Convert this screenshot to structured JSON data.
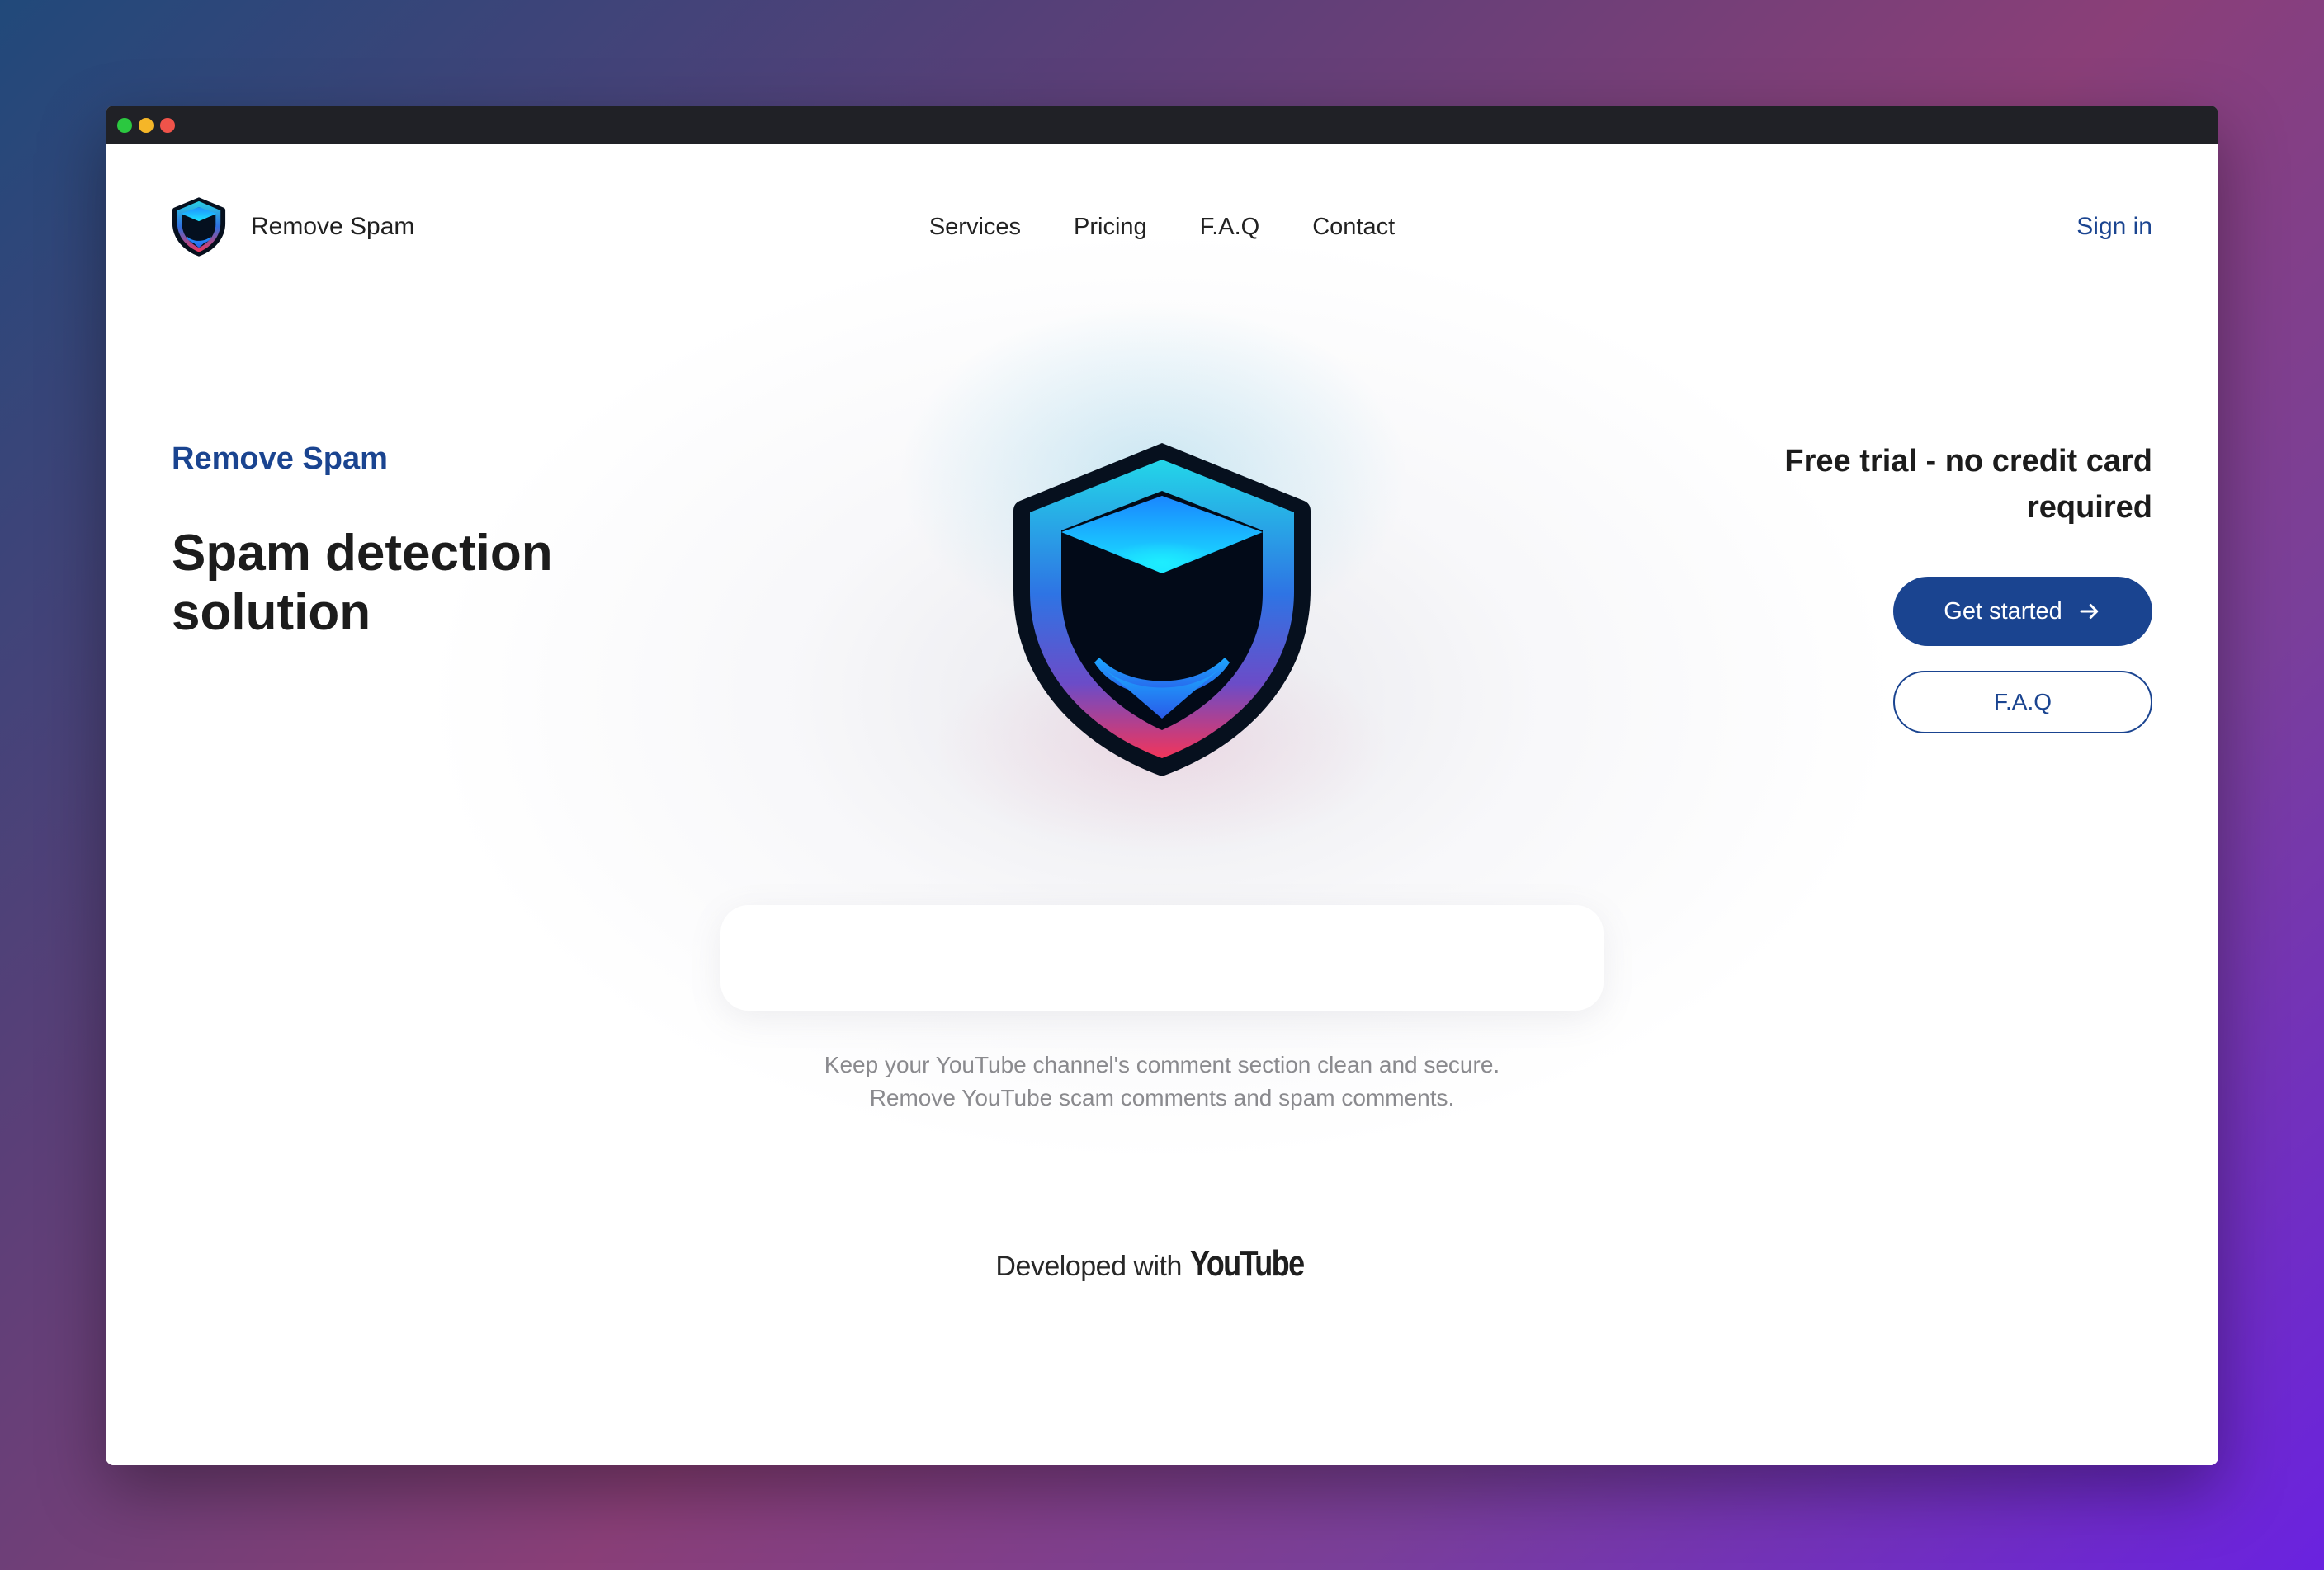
{
  "window": {
    "controls": [
      "close",
      "minimize",
      "maximize"
    ]
  },
  "nav": {
    "brand_name": "Remove Spam",
    "brand_icon": "shield-logo-icon",
    "links": [
      {
        "label": "Services"
      },
      {
        "label": "Pricing"
      },
      {
        "label": "F.A.Q"
      },
      {
        "label": "Contact"
      }
    ],
    "signin_label": "Sign in"
  },
  "hero": {
    "eyebrow": "Remove Spam",
    "title": "Spam detection solution",
    "trial_text": "Free trial - no credit card required",
    "get_started_label": "Get started",
    "get_started_icon": "arrow-right-icon",
    "faq_label": "F.A.Q",
    "shield_icon": "shield-logo-icon"
  },
  "tagline": {
    "line1": "Keep your YouTube channel's comment section clean and secure.",
    "line2": "Remove YouTube scam comments and spam comments."
  },
  "footer": {
    "developed_with": "Developed with",
    "youtube_wordmark": "YouTube"
  },
  "colors": {
    "brand": "#1a4490",
    "titlebar": "#202126",
    "text": "#1c1c1c",
    "muted": "#8a8a8e"
  }
}
